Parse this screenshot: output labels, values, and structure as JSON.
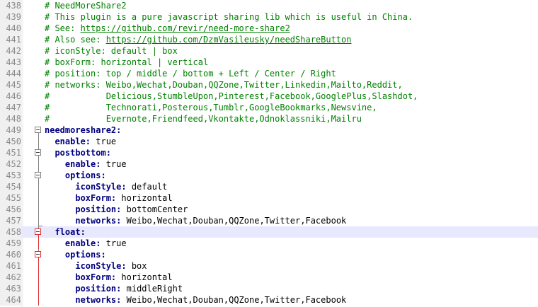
{
  "editor": {
    "lines": [
      {
        "n": "438",
        "indent": "",
        "kind": "comment",
        "text": "# NeedMoreShare2"
      },
      {
        "n": "439",
        "indent": "",
        "kind": "comment",
        "text": "# This plugin is a pure javascript sharing lib which is useful in China."
      },
      {
        "n": "440",
        "indent": "",
        "kind": "comment",
        "text": "# See: ",
        "link": "https://github.com/revir/need-more-share2"
      },
      {
        "n": "441",
        "indent": "",
        "kind": "comment",
        "text": "# Also see: ",
        "link": "https://github.com/DzmVasileusky/needShareButton"
      },
      {
        "n": "442",
        "indent": "",
        "kind": "comment",
        "text": "# iconStyle: default | box"
      },
      {
        "n": "443",
        "indent": "",
        "kind": "comment",
        "text": "# boxForm: horizontal | vertical"
      },
      {
        "n": "444",
        "indent": "",
        "kind": "comment",
        "text": "# position: top / middle / bottom + Left / Center / Right"
      },
      {
        "n": "445",
        "indent": "",
        "kind": "comment",
        "text": "# networks: Weibo,Wechat,Douban,QQZone,Twitter,Linkedin,Mailto,Reddit,"
      },
      {
        "n": "446",
        "indent": "",
        "kind": "comment",
        "text": "#           Delicious,StumbleUpon,Pinterest,Facebook,GooglePlus,Slashdot,"
      },
      {
        "n": "447",
        "indent": "",
        "kind": "comment",
        "text": "#           Technorati,Posterous,Tumblr,GoogleBookmarks,Newsvine,"
      },
      {
        "n": "448",
        "indent": "",
        "kind": "comment",
        "text": "#           Evernote,Friendfeed,Vkontakte,Odnoklassniki,Mailru"
      },
      {
        "n": "449",
        "indent": "",
        "kind": "kv",
        "key": "needmoreshare2:",
        "value": "",
        "fold": "box"
      },
      {
        "n": "450",
        "indent": "  ",
        "kind": "kv",
        "key": "enable:",
        "value": " true",
        "fold": "line"
      },
      {
        "n": "451",
        "indent": "  ",
        "kind": "kv",
        "key": "postbottom:",
        "value": "",
        "fold": "box"
      },
      {
        "n": "452",
        "indent": "    ",
        "kind": "kv",
        "key": "enable:",
        "value": " true",
        "fold": "line"
      },
      {
        "n": "453",
        "indent": "    ",
        "kind": "kv",
        "key": "options:",
        "value": "",
        "fold": "box"
      },
      {
        "n": "454",
        "indent": "      ",
        "kind": "kv",
        "key": "iconStyle:",
        "value": " default",
        "fold": "line"
      },
      {
        "n": "455",
        "indent": "      ",
        "kind": "kv",
        "key": "boxForm:",
        "value": " horizontal",
        "fold": "line"
      },
      {
        "n": "456",
        "indent": "      ",
        "kind": "kv",
        "key": "position:",
        "value": " bottomCenter",
        "fold": "line"
      },
      {
        "n": "457",
        "indent": "      ",
        "kind": "kv",
        "key": "networks:",
        "value": " Weibo,Wechat,Douban,QQZone,Twitter,Facebook",
        "fold": "end"
      },
      {
        "n": "458",
        "indent": "  ",
        "kind": "kv",
        "key": "float:",
        "value": "",
        "fold": "redbox",
        "current": true
      },
      {
        "n": "459",
        "indent": "    ",
        "kind": "kv",
        "key": "enable:",
        "value": " true",
        "fold": "redline"
      },
      {
        "n": "460",
        "indent": "    ",
        "kind": "kv",
        "key": "options:",
        "value": "",
        "fold": "redbox"
      },
      {
        "n": "461",
        "indent": "      ",
        "kind": "kv",
        "key": "iconStyle:",
        "value": " box",
        "fold": "redline"
      },
      {
        "n": "462",
        "indent": "      ",
        "kind": "kv",
        "key": "boxForm:",
        "value": " horizontal",
        "fold": "redline"
      },
      {
        "n": "463",
        "indent": "      ",
        "kind": "kv",
        "key": "position:",
        "value": " middleRight",
        "fold": "redline"
      },
      {
        "n": "464",
        "indent": "      ",
        "kind": "kv",
        "key": "networks:",
        "value": " Weibo,Wechat,Douban,QQZone,Twitter,Facebook",
        "fold": "redline"
      }
    ]
  },
  "colors": {
    "comment": "#008000",
    "key": "#000080",
    "current_line": "#e8e8ff",
    "fold_active": "#e03030"
  }
}
